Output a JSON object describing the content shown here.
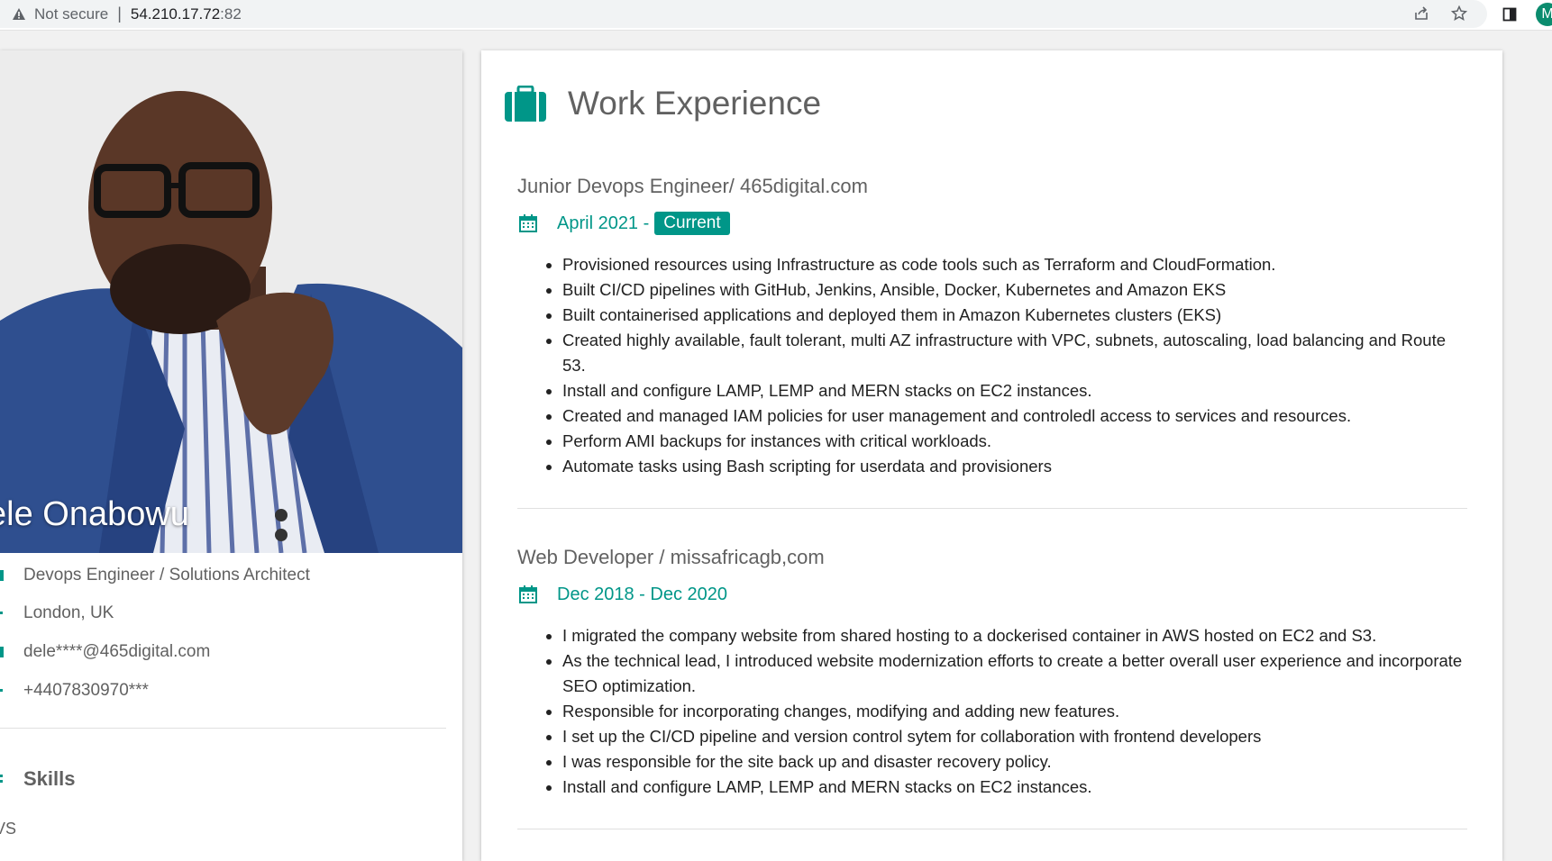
{
  "browser": {
    "security_label": "Not secure",
    "url_host": "54.210.17.72",
    "url_port": ":82",
    "profile_initial": "M"
  },
  "profile": {
    "name": "ele Onabowu",
    "role": "Devops Engineer / Solutions Architect",
    "location": "London, UK",
    "email": "dele****@465digital.com",
    "phone": "+4407830970***",
    "skills_heading": "Skills",
    "first_skill": "VS"
  },
  "experience": {
    "heading": "Work Experience",
    "jobs": [
      {
        "title": "Junior Devops Engineer/ 465digital.com",
        "date": "April 2021 -",
        "badge": "Current",
        "bullets": [
          "Provisioned resources using Infrastructure as code tools such as Terraform and CloudFormation.",
          "Built CI/CD pipelines with GitHub, Jenkins, Ansible, Docker, Kubernetes and Amazon EKS",
          "Built containerised applications and deployed them in Amazon Kubernetes clusters (EKS)",
          "Created highly available, fault tolerant, multi AZ infrastructure with VPC, subnets, autoscaling, load balancing and Route 53.",
          "Install and configure LAMP, LEMP and MERN stacks on EC2 instances.",
          "Created and managed IAM policies for user management and controledl access to services and resources.",
          "Perform AMI backups for instances with critical workloads.",
          "Automate tasks using Bash scripting for userdata and provisioners"
        ]
      },
      {
        "title": "Web Developer / missafricagb,com",
        "date": "Dec 2018 - Dec 2020",
        "bullets": [
          "I migrated the company website from shared hosting to a dockerised container in AWS hosted on EC2 and S3.",
          "As the technical lead, I introduced website modernization efforts to create a better overall user experience and incorporate SEO optimization.",
          "Responsible for incorporating changes, modifying and adding new features.",
          "I set up the CI/CD pipeline and version control sytem for collaboration with frontend developers",
          "I was responsible for the site back up and disaster recovery policy.",
          "Install and configure LAMP, LEMP and MERN stacks on EC2 instances."
        ]
      }
    ]
  },
  "colors": {
    "accent": "#009688",
    "text_muted": "#616161"
  }
}
